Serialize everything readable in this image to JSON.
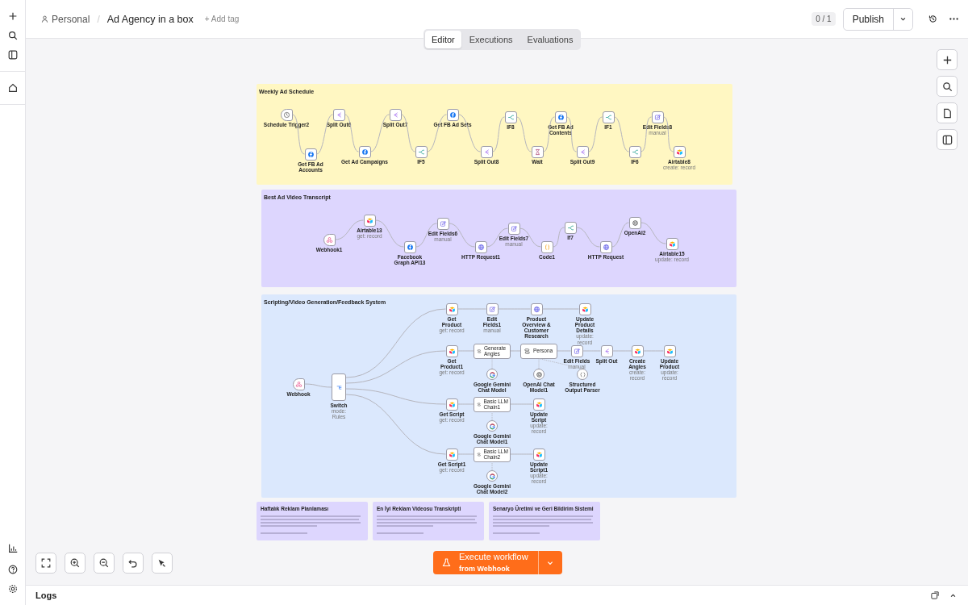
{
  "breadcrumb": {
    "project": "Personal",
    "separator": "/",
    "workflow": "Ad Agency in a box",
    "add_tag": "+ Add tag"
  },
  "counter": "0 / 1",
  "publish": "Publish",
  "tabs": [
    {
      "label": "Editor",
      "selected": true
    },
    {
      "label": "Executions",
      "selected": false
    },
    {
      "label": "Evaluations",
      "selected": false
    }
  ],
  "groups": [
    {
      "title": "Weekly Ad Schedule",
      "color": "#fff7c2",
      "nodes": [
        {
          "label": "Schedule Trigger2",
          "kind": "schedule"
        },
        {
          "label": "Get FB Ad Accounts",
          "kind": "facebook"
        },
        {
          "label": "Split Out6",
          "kind": "split"
        },
        {
          "label": "Get Ad Campaigns",
          "kind": "facebook"
        },
        {
          "label": "Split Out7",
          "kind": "split"
        },
        {
          "label": "IF5",
          "kind": "if"
        },
        {
          "label": "Get FB Ad Sets",
          "kind": "facebook"
        },
        {
          "label": "Split Out8",
          "kind": "split"
        },
        {
          "label": "IF8",
          "kind": "if"
        },
        {
          "label": "Wait",
          "kind": "wait"
        },
        {
          "label": "Get FB Ad Contents",
          "kind": "facebook"
        },
        {
          "label": "Split Out9",
          "kind": "split"
        },
        {
          "label": "IF1",
          "kind": "if"
        },
        {
          "label": "IF6",
          "kind": "if"
        },
        {
          "label": "Edit Fields8",
          "subtitle": "manual",
          "kind": "edit"
        },
        {
          "label": "Airtable8",
          "subtitle": "create: record",
          "kind": "airtable"
        }
      ]
    },
    {
      "title": "Best Ad Video Transcript",
      "color": "#ddd6fe",
      "nodes": [
        {
          "label": "Webhook1",
          "kind": "webhook"
        },
        {
          "label": "Airtable13",
          "subtitle": "get: record",
          "kind": "airtable"
        },
        {
          "label": "Facebook Graph API13",
          "kind": "facebook"
        },
        {
          "label": "Edit Fields6",
          "subtitle": "manual",
          "kind": "edit"
        },
        {
          "label": "HTTP Request1",
          "kind": "http"
        },
        {
          "label": "Edit Fields7",
          "subtitle": "manual",
          "kind": "edit"
        },
        {
          "label": "Code1",
          "kind": "code"
        },
        {
          "label": "If7",
          "kind": "if"
        },
        {
          "label": "HTTP Request",
          "kind": "http"
        },
        {
          "label": "OpenAI2",
          "kind": "openai"
        },
        {
          "label": "Airtable15",
          "subtitle": "update: record",
          "kind": "airtable"
        }
      ]
    },
    {
      "title": "Scripting/Video Generation/Feedback System",
      "color": "#dbe8fd",
      "nodes": [
        {
          "label": "Webhook",
          "kind": "webhook"
        },
        {
          "label": "Switch",
          "subtitle": "mode: Rules",
          "kind": "switch"
        },
        {
          "label": "Get Product",
          "subtitle": "get: record",
          "kind": "airtable"
        },
        {
          "label": "Edit Fields1",
          "subtitle": "manual",
          "kind": "edit"
        },
        {
          "label": "Product Overview & Customer Research",
          "kind": "http"
        },
        {
          "label": "Update Product Details",
          "subtitle": "update: record",
          "kind": "airtable"
        },
        {
          "label": "Get Product1",
          "subtitle": "get: record",
          "kind": "airtable"
        },
        {
          "label": "Generate Angles",
          "kind": "chain"
        },
        {
          "label": "Persona",
          "kind": "chain"
        },
        {
          "label": "Edit Fields",
          "subtitle": "manual",
          "kind": "edit"
        },
        {
          "label": "Split Out",
          "kind": "split"
        },
        {
          "label": "Create Angles",
          "subtitle": "create: record",
          "kind": "airtable"
        },
        {
          "label": "Update Product",
          "subtitle": "update: record",
          "kind": "airtable"
        },
        {
          "label": "Google Gemini Chat Model",
          "kind": "gemini"
        },
        {
          "label": "OpenAI Chat Model1",
          "kind": "openai-model"
        },
        {
          "label": "Structured Output Parser",
          "kind": "parser"
        },
        {
          "label": "Get Script",
          "subtitle": "get: record",
          "kind": "airtable"
        },
        {
          "label": "Basic LLM Chain1",
          "kind": "chain"
        },
        {
          "label": "Update Script",
          "subtitle": "update: record",
          "kind": "airtable"
        },
        {
          "label": "Google Gemini Chat Model1",
          "kind": "gemini"
        },
        {
          "label": "Get Script1",
          "subtitle": "get: record",
          "kind": "airtable"
        },
        {
          "label": "Basic LLM Chain2",
          "kind": "chain"
        },
        {
          "label": "Update Script1",
          "subtitle": "update: record",
          "kind": "airtable"
        },
        {
          "label": "Google Gemini Chat Model2",
          "kind": "gemini"
        }
      ]
    }
  ],
  "notes": [
    {
      "title": "Haftalık Reklam Planlaması"
    },
    {
      "title": "En İyi Reklam Videosu Transkripti"
    },
    {
      "title": "Senaryo Üretimi ve Geri Bildirim Sistemi"
    }
  ],
  "execute": {
    "label": "Execute workflow",
    "sublabel": "from Webhook"
  },
  "logs": "Logs"
}
